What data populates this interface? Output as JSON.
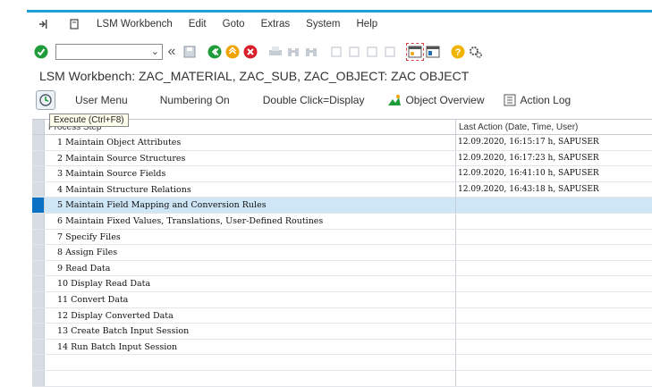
{
  "menu": {
    "items": [
      "LSM Workbench",
      "Edit",
      "Goto",
      "Extras",
      "System",
      "Help"
    ]
  },
  "toolbar": {
    "command_value": ""
  },
  "title": "LSM Workbench: ZAC_MATERIAL, ZAC_SUB, ZAC_OBJECT: ZAC OBJECT",
  "app_toolbar": {
    "user_menu": "User Menu",
    "numbering_on": "Numbering On",
    "double_click": "Double Click=Display",
    "object_overview": "Object Overview",
    "action_log": "Action Log"
  },
  "tooltip": "Execute  (Ctrl+F8)",
  "table": {
    "col1": "Process Step",
    "col2": "Last Action (Date, Time, User)",
    "rows": [
      {
        "step": "1 Maintain Object Attributes",
        "last": "12.09.2020, 16:15:17 h, SAPUSER"
      },
      {
        "step": "2 Maintain Source Structures",
        "last": "12.09.2020, 16:17:23 h, SAPUSER"
      },
      {
        "step": "3 Maintain Source Fields",
        "last": "12.09.2020, 16:41:10 h, SAPUSER"
      },
      {
        "step": "4 Maintain Structure Relations",
        "last": "12.09.2020, 16:43:18 h, SAPUSER"
      },
      {
        "step": "5 Maintain Field Mapping and Conversion Rules",
        "last": ""
      },
      {
        "step": "6 Maintain Fixed Values, Translations, User-Defined Routines",
        "last": ""
      },
      {
        "step": "7 Specify Files",
        "last": ""
      },
      {
        "step": "8 Assign Files",
        "last": ""
      },
      {
        "step": "9 Read Data",
        "last": ""
      },
      {
        "step": "10 Display Read Data",
        "last": ""
      },
      {
        "step": "11 Convert Data",
        "last": ""
      },
      {
        "step": "12 Display Converted Data",
        "last": ""
      },
      {
        "step": "13 Create Batch Input Session",
        "last": ""
      },
      {
        "step": "14 Run Batch Input Session",
        "last": ""
      }
    ]
  }
}
